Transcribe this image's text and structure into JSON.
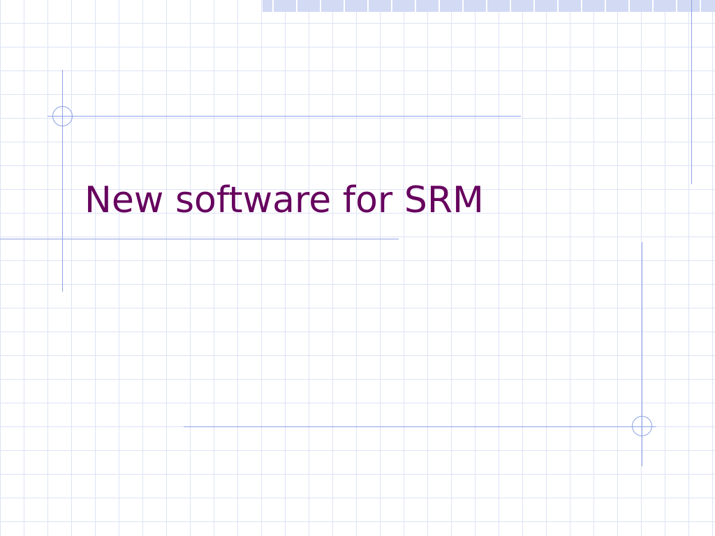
{
  "slide": {
    "title": "New software for SRM"
  },
  "colors": {
    "title_text": "#66005e",
    "accent_line": "#8fa2e4",
    "grid": "#dde3f6",
    "top_strip": "#d2daf4",
    "background": "#ffffff"
  }
}
